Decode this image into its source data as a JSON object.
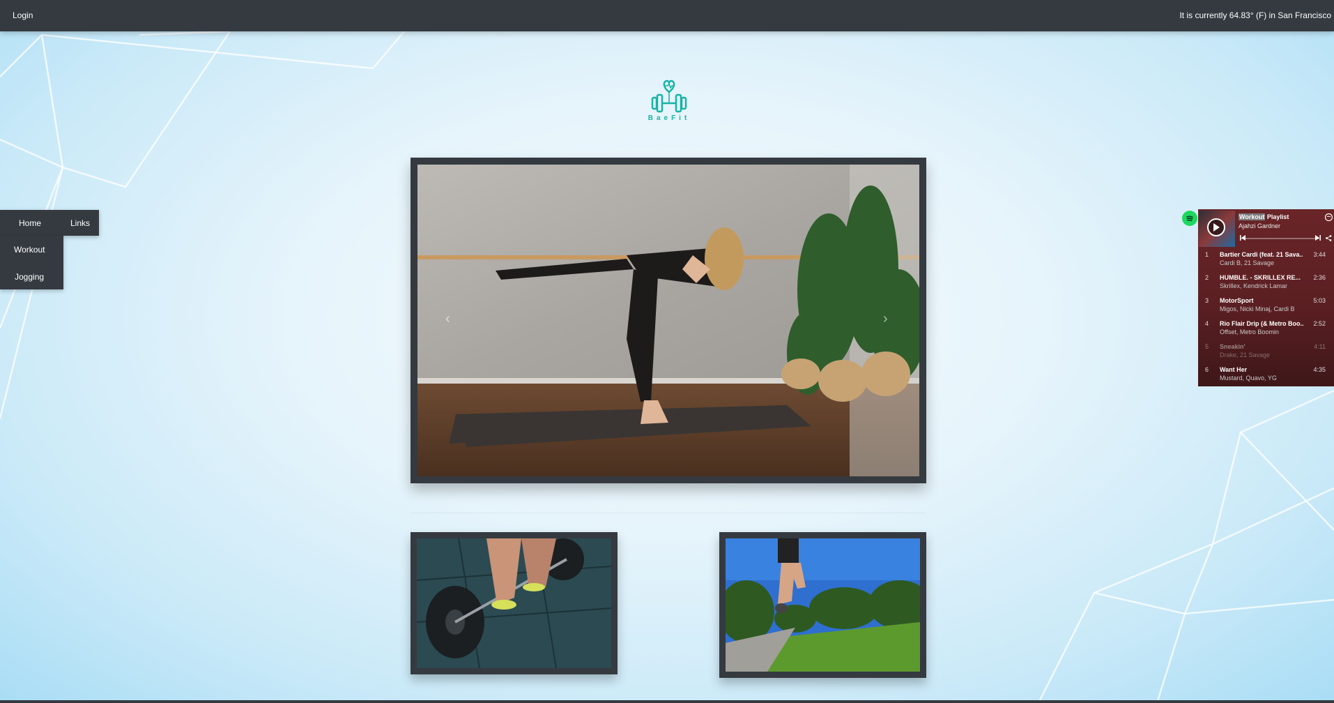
{
  "topbar": {
    "login_label": "Login",
    "weather_text": "It is currently 64.83° (F) in San Francisco"
  },
  "brand": {
    "name": "BaeFit",
    "color": "#18b2a7"
  },
  "nav": {
    "top": [
      {
        "label": "Home"
      },
      {
        "label": "Links"
      }
    ],
    "sub": [
      {
        "label": "Workout"
      },
      {
        "label": "Jogging"
      }
    ]
  },
  "carousel": {
    "prev_glyph": "‹",
    "next_glyph": "›"
  },
  "spotify": {
    "playlist_highlight": "Workout",
    "playlist_rest": " Playlist",
    "owner": "Ajahzi Gardner",
    "tracks": [
      {
        "num": "1",
        "title": "Bartier Cardi (feat. 21 Sava...",
        "artist": "Cardi B, 21 Savage",
        "duration": "3:44"
      },
      {
        "num": "2",
        "title": "HUMBLE. - SKRILLEX RE...",
        "artist": "Skrillex, Kendrick Lamar",
        "duration": "2:36"
      },
      {
        "num": "3",
        "title": "MotorSport",
        "artist": "Migos, Nicki Minaj, Cardi B",
        "duration": "5:03"
      },
      {
        "num": "4",
        "title": "Rio Flair Drip (& Metro Boo...",
        "artist": "Offset, Metro Boomin",
        "duration": "2:52"
      },
      {
        "num": "5",
        "title": "Sneakin'",
        "artist": "Drake, 21 Savage",
        "duration": "4:11"
      },
      {
        "num": "6",
        "title": "Want Her",
        "artist": "Mustard, Quavo, YG",
        "duration": "4:35"
      }
    ],
    "colors": {
      "bg": "#6a2528",
      "badge": "#1ed760"
    }
  },
  "colors": {
    "bar": "#343a40",
    "accent": "#18b2a7"
  }
}
